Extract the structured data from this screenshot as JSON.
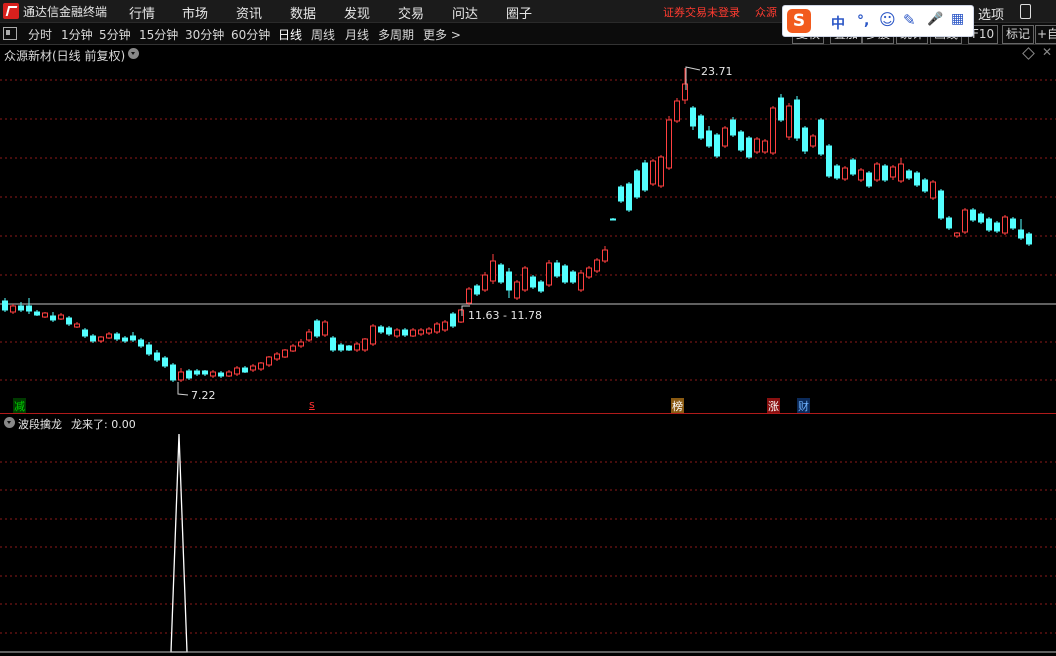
{
  "app": {
    "title": "通达信金融终端",
    "menu": [
      "行情",
      "市场",
      "资讯",
      "数据",
      "发现",
      "交易",
      "问达",
      "圈子"
    ],
    "login_warning": "证券交易未登录",
    "account_text": "众源",
    "options_label": "选项",
    "ime": {
      "logo": "S",
      "items": [
        "中",
        "°,",
        "☺",
        "✎",
        "🎤",
        "▦"
      ]
    }
  },
  "toolbar": {
    "periods": [
      "分时",
      "1分钟",
      "5分钟",
      "15分钟",
      "30分钟",
      "60分钟",
      "日线",
      "周线",
      "月线",
      "多周期",
      "更多 >"
    ],
    "active": "日线",
    "right_buttons": [
      "复权",
      "叠加",
      "多股",
      "统计",
      "画线",
      "F10",
      "标记",
      "+自"
    ]
  },
  "main_chart": {
    "stock_title": "众源新材(日线 前复权)",
    "colors": {
      "up": "#ff4040",
      "down": "#54ffff",
      "grid": "#8b1a1a",
      "axis": "#c0c0c0"
    },
    "annotations": {
      "high_label": "23.71",
      "low_label": "7.22",
      "range_label": "11.63 - 11.78"
    },
    "signals": [
      {
        "text": "减",
        "color": "#00c000",
        "bg": "#004d00"
      },
      {
        "text": "s",
        "color": "#ff3030",
        "bg": ""
      },
      {
        "text": "榜",
        "color": "#ffffff",
        "bg": "#8a5a12"
      },
      {
        "text": "涨",
        "color": "#ffffff",
        "bg": "#8a1010"
      },
      {
        "text": "财",
        "color": "#6fb2ff",
        "bg": "#0b2a5a"
      }
    ]
  },
  "indicator": {
    "title": "波段擒龙",
    "value_label": "龙来了: 0.00"
  }
}
